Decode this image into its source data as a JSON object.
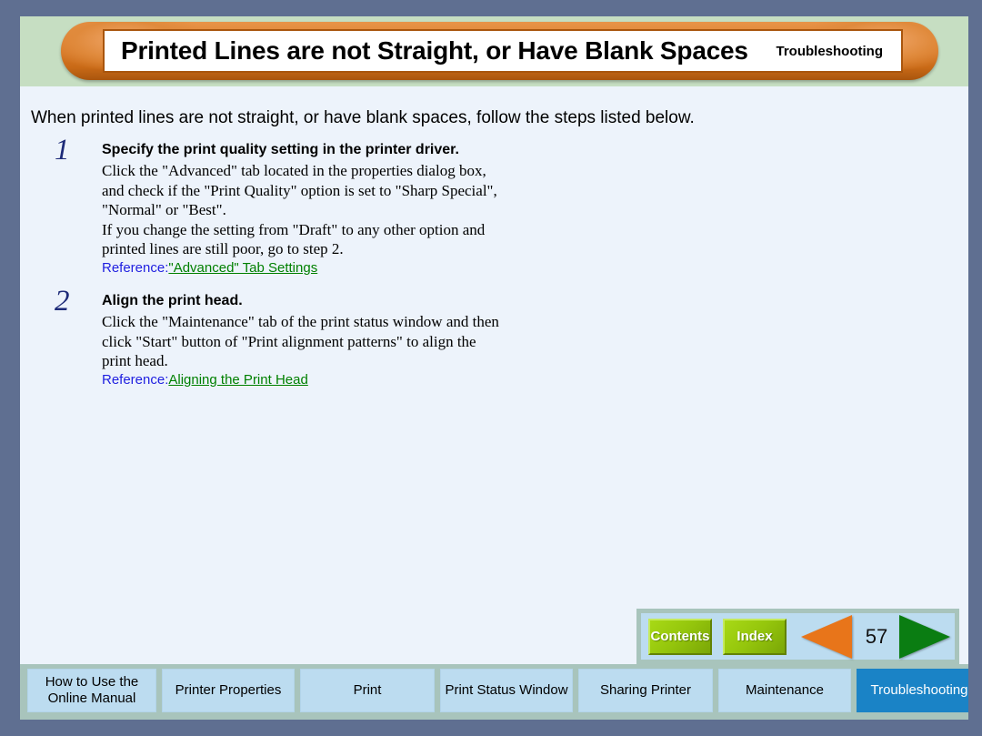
{
  "header": {
    "title": "Printed Lines are not Straight, or Have Blank Spaces",
    "section": "Troubleshooting"
  },
  "content": {
    "intro": "When printed lines are not straight, or have blank spaces, follow the steps listed below.",
    "steps": [
      {
        "number": "1",
        "heading": "Specify the print quality setting in the printer driver.",
        "body": "Click the \"Advanced\" tab located in the properties dialog box, and check if the \"Print Quality\" option is set to \"Sharp Special\", \"Normal\" or \"Best\".\nIf you change the setting from \"Draft\" to any other option and printed lines are still poor, go to step 2.",
        "reference_label": "Reference:",
        "reference_link": "\"Advanced\" Tab Settings"
      },
      {
        "number": "2",
        "heading": "Align the print head.",
        "body": "Click the \"Maintenance\" tab of the print status window and then click \"Start\" button of \"Print alignment patterns\" to align the print head.",
        "reference_label": "Reference:",
        "reference_link": "Aligning the Print Head"
      }
    ]
  },
  "nav": {
    "contents_label": "Contents",
    "index_label": "Index",
    "prev_icon": "left-triangle-icon",
    "next_icon": "right-triangle-icon",
    "page_number": "57"
  },
  "tabs": [
    {
      "label": "How to Use the Online Manual",
      "active": false
    },
    {
      "label": "Printer Properties",
      "active": false
    },
    {
      "label": "Print",
      "active": false
    },
    {
      "label": "Print Status Window",
      "active": false
    },
    {
      "label": "Sharing Printer",
      "active": false
    },
    {
      "label": "Maintenance",
      "active": false
    },
    {
      "label": "Troubleshooting",
      "active": true
    }
  ],
  "colors": {
    "outer_frame": "#5f6f91",
    "header_band": "#c6dec2",
    "title_pill": "#d9772a",
    "page_background": "#edf3fb",
    "tab_background": "#bcdcf0",
    "tab_active": "#1a83c6",
    "tab_strip": "#a8c4bc",
    "green_button": "#95c60c",
    "prev_arrow": "#e8751a",
    "next_arrow": "#0a7d12",
    "step_number": "#1d2a78",
    "reference_label": "#1f1fe0",
    "reference_link": "#008000"
  }
}
